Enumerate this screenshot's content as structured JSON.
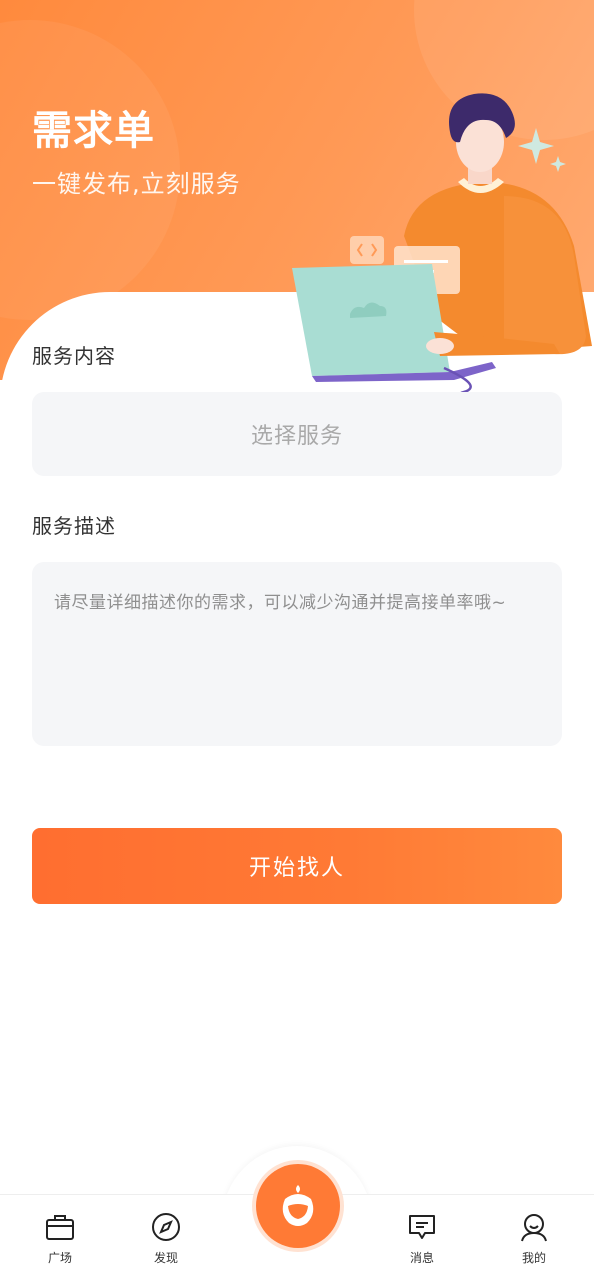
{
  "header": {
    "title": "需求单",
    "subtitle": "一键发布,立刻服务"
  },
  "form": {
    "service_label": "服务内容",
    "service_placeholder": "选择服务",
    "description_label": "服务描述",
    "description_placeholder": "请尽量详细描述你的需求，可以减少沟通并提高接单率哦~",
    "submit_label": "开始找人"
  },
  "tabbar": {
    "items": [
      {
        "label": "广场",
        "icon": "briefcase-icon"
      },
      {
        "label": "发现",
        "icon": "compass-icon"
      },
      {
        "label": "",
        "icon": "center-mascot-icon"
      },
      {
        "label": "消息",
        "icon": "message-icon"
      },
      {
        "label": "我的",
        "icon": "user-icon"
      }
    ]
  },
  "colors": {
    "accent": "#ff7a35",
    "hero_gradient_start": "#ff8a3d",
    "hero_gradient_end": "#ffab73",
    "field_bg": "#f5f6f8"
  }
}
